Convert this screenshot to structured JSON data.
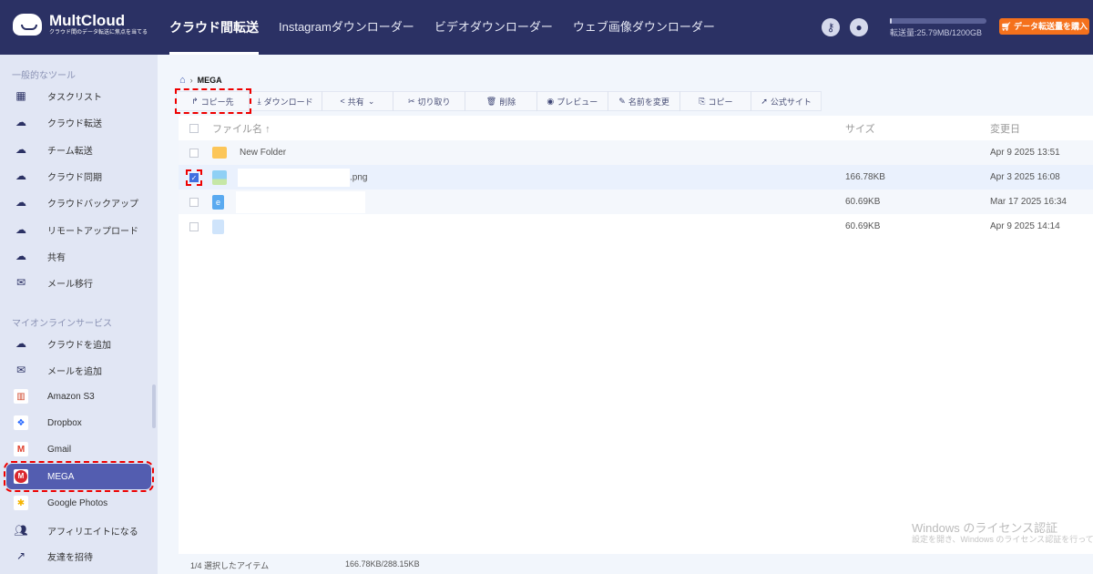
{
  "header": {
    "logo_title": "MultCloud",
    "logo_sub": "クラウド間のデータ転送に焦点を当てる",
    "nav": [
      "クラウド間転送",
      "Instagramダウンローダー",
      "ビデオダウンローダー",
      "ウェブ画像ダウンローダー"
    ],
    "quota_text": "転送量:25.79MB/1200GB",
    "quota_fraction": 2e-05,
    "buy_label": "データ転送量を購入"
  },
  "sidebar": {
    "section1": "一般的なツール",
    "tools": [
      "タスクリスト",
      "クラウド転送",
      "チーム転送",
      "クラウド同期",
      "クラウドバックアップ",
      "リモートアップロード",
      "共有",
      "メール移行"
    ],
    "section2": "マイオンラインサービス",
    "services": [
      "クラウドを追加",
      "メールを追加",
      "Amazon S3",
      "Dropbox",
      "Gmail",
      "MEGA",
      "Google Photos",
      "アフィリエイトになる",
      "友達を招待"
    ]
  },
  "breadcrumb": {
    "current": "MEGA"
  },
  "toolbar": [
    "コピー先",
    "ダウンロード",
    "共有",
    "切り取り",
    "削除",
    "プレビュー",
    "名前を変更",
    "コピー",
    "公式サイト"
  ],
  "table": {
    "headers": {
      "name": "ファイル名",
      "size": "サイズ",
      "modified": "変更日"
    },
    "rows": [
      {
        "name": "New Folder",
        "size": "",
        "date": "Apr 9 2025 13:51"
      },
      {
        "name": ".png",
        "size": "166.78KB",
        "date": "Apr 3 2025 16:08"
      },
      {
        "name": "",
        "size": "60.69KB",
        "date": "Mar 17 2025 16:34"
      },
      {
        "name": "",
        "size": "60.69KB",
        "date": "Apr 9 2025 14:14"
      }
    ]
  },
  "status": {
    "selection": "1/4 選択したアイテム",
    "size": "166.78KB/288.15KB"
  },
  "watermark": {
    "title": "Windows のライセンス認証",
    "sub": "設定を開き、Windows のライセンス認証を行ってください。"
  }
}
